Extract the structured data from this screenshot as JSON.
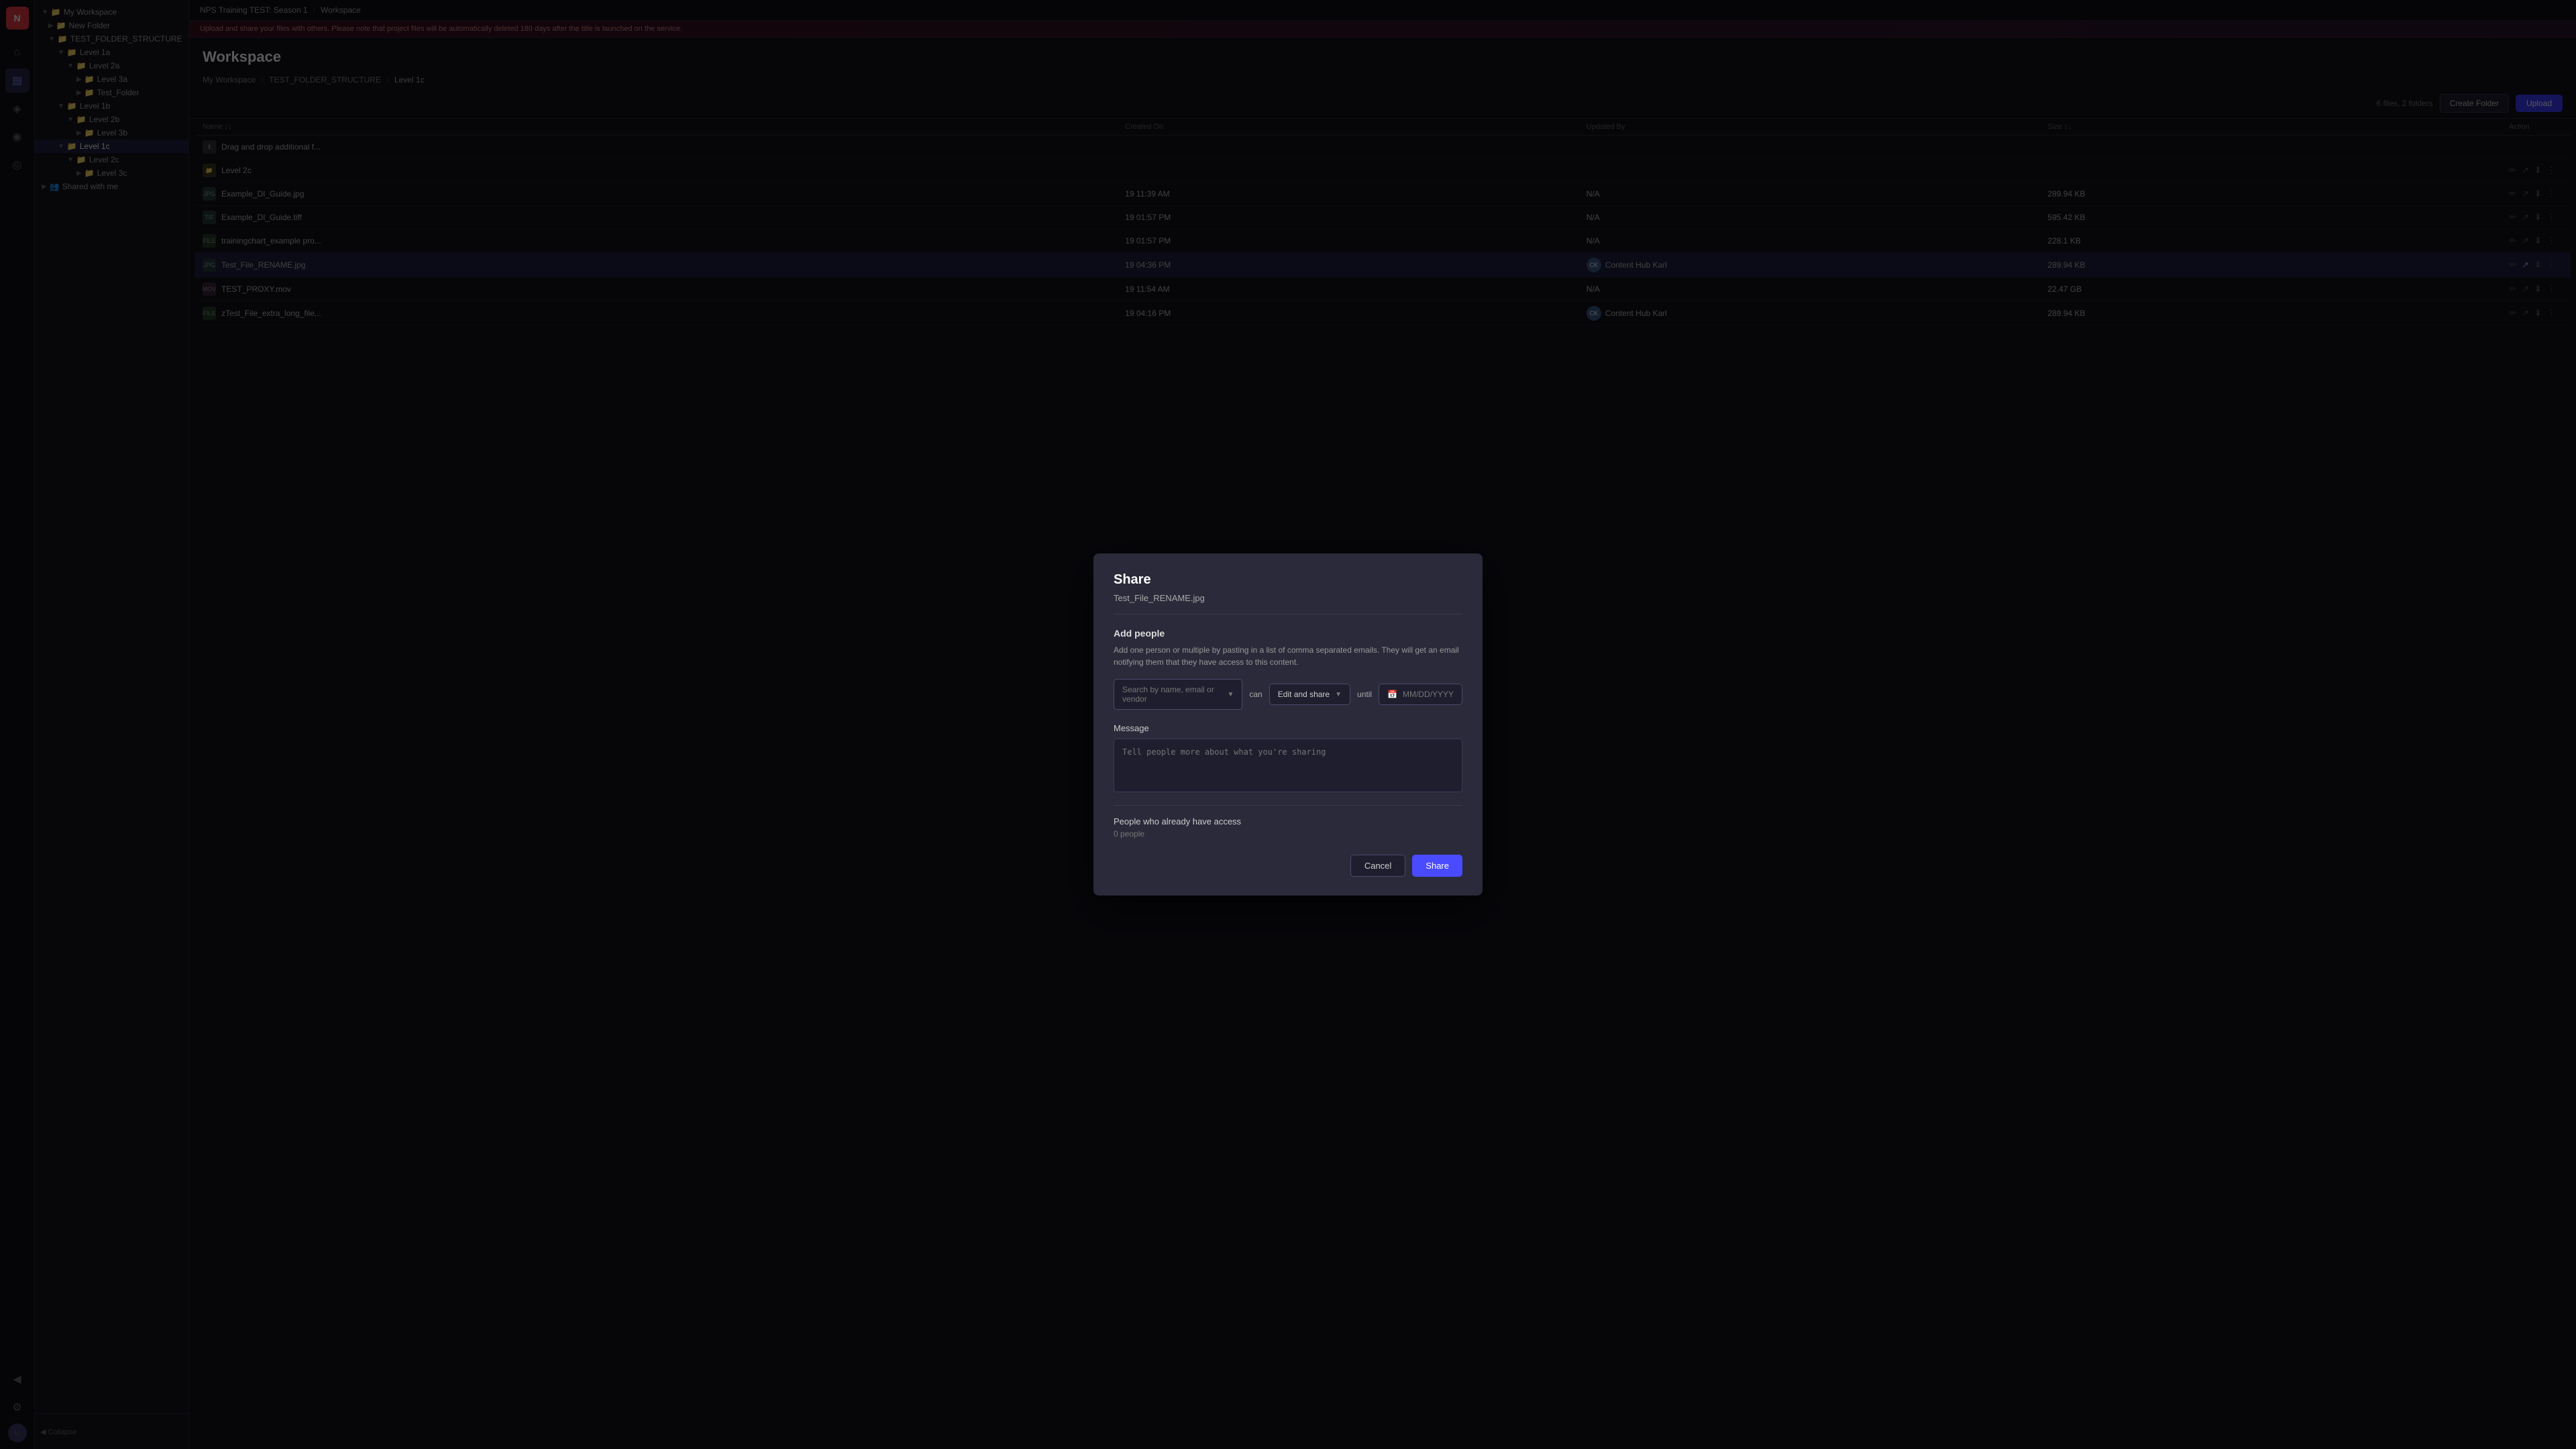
{
  "app": {
    "logo": "N",
    "nav": {
      "breadcrumb1": "NPS Training TEST: Season 1",
      "breadcrumb2": "Workspace"
    }
  },
  "sidebar": {
    "items": [
      {
        "label": "My Workspace",
        "indent": 0,
        "type": "folder"
      },
      {
        "label": "New Folder",
        "indent": 1,
        "type": "folder"
      },
      {
        "label": "TEST_FOLDER_STRUCTURE",
        "indent": 1,
        "type": "folder"
      },
      {
        "label": "Level 1a",
        "indent": 2,
        "type": "folder"
      },
      {
        "label": "Level 2a",
        "indent": 3,
        "type": "folder"
      },
      {
        "label": "Level 3a",
        "indent": 4,
        "type": "folder"
      },
      {
        "label": "Test_Folder",
        "indent": 4,
        "type": "folder"
      },
      {
        "label": "Level 1b",
        "indent": 2,
        "type": "folder"
      },
      {
        "label": "Level 2b",
        "indent": 3,
        "type": "folder"
      },
      {
        "label": "Level 3b",
        "indent": 4,
        "type": "folder"
      },
      {
        "label": "Level 1c",
        "indent": 2,
        "type": "folder",
        "active": true
      },
      {
        "label": "Level 2c",
        "indent": 3,
        "type": "folder"
      },
      {
        "label": "Level 3c",
        "indent": 4,
        "type": "folder"
      },
      {
        "label": "Shared with me",
        "indent": 0,
        "type": "shared"
      }
    ]
  },
  "workspace": {
    "title": "Workspace",
    "alert": "Upload and share your files with others. Please note that project files will be automatically deleted 180 days after the title is launched on the service.",
    "breadcrumb": [
      "My Workspace",
      "TEST_FOLDER_STRUCTURE",
      "Level 1c"
    ],
    "file_count": "6 files, 2 folders",
    "create_folder_label": "Create Folder",
    "upload_label": "Upload"
  },
  "table": {
    "headers": [
      "Name",
      "",
      "Created On",
      "Updated By",
      "Size",
      "Action"
    ],
    "rows": [
      {
        "name": "Drag and drop additional f...",
        "type": "drag",
        "created": "",
        "updated_by": "",
        "updated_avatar": "",
        "size": "",
        "highlighted": false
      },
      {
        "name": "Level 2c",
        "type": "folder",
        "created": "",
        "updated_by": "",
        "size": "",
        "highlighted": false
      },
      {
        "name": "Example_DI_Guide.jpg",
        "type": "jpg",
        "created": "19 11:39 AM",
        "updated_by": "N/A",
        "size": "289.94 KB",
        "highlighted": false
      },
      {
        "name": "Example_DI_Guide.tiff",
        "type": "tiff",
        "created": "19 01:57 PM",
        "updated_by": "N/A",
        "size": "595.42 KB",
        "highlighted": false
      },
      {
        "name": "trainingchart_example pro...",
        "type": "file",
        "created": "19 01:57 PM",
        "updated_by": "N/A",
        "size": "228.1 KB",
        "highlighted": false
      },
      {
        "name": "Test_File_RENAME.jpg",
        "type": "jpg",
        "created": "19 04:36 PM",
        "updated_by": "Content Hub Karl",
        "size": "289.94 KB",
        "highlighted": true
      },
      {
        "name": "TEST_PROXY.mov",
        "type": "mov",
        "created": "19 11:54 AM",
        "updated_by": "N/A",
        "size": "22.47 GB",
        "highlighted": false
      },
      {
        "name": "zTest_File_extra_long_file...",
        "type": "file",
        "created": "19 04:16 PM",
        "updated_by": "Content Hub Karl",
        "size": "289.94 KB",
        "highlighted": false
      }
    ]
  },
  "modal": {
    "title": "Share",
    "filename": "Test_File_RENAME.jpg",
    "add_people_title": "Add people",
    "add_people_desc": "Add one person or multiple by pasting in a list of comma separated emails. They will get an email notifying them that they have access to this content.",
    "search_placeholder": "Search by name, email or vendor",
    "can_label": "can",
    "permission_label": "Edit and share",
    "until_label": "until",
    "date_placeholder": "MM/DD/YYYY",
    "message_label": "Message",
    "message_placeholder": "Tell people more about what you're sharing",
    "people_access_title": "People who already have access",
    "people_count": "0 people",
    "cancel_label": "Cancel",
    "share_label": "Share"
  },
  "colors": {
    "accent": "#4a4aff",
    "danger": "#e63946",
    "highlighted_row": "#1e2040"
  }
}
